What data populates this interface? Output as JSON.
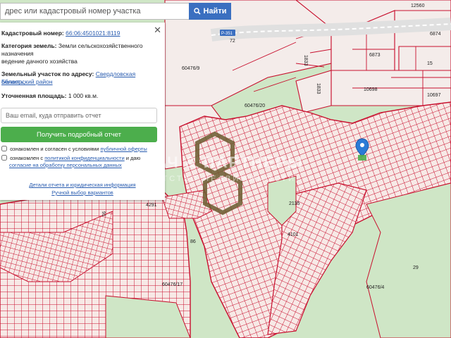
{
  "search": {
    "placeholder": "дрес или кадастровый номер участка",
    "button": "Найти"
  },
  "panel": {
    "cadastral_label": "Кадастровый номер:",
    "cadastral_value": "66:06:4501021:8119",
    "category_label": "Категория земель:",
    "category_value": "Земли сельскохозяйственного",
    "category_value_2": "назначения",
    "use_value": "ведение дачного хозяйства",
    "address_label": "Земельный участок по адресу:",
    "address_value": "Свердловская область,",
    "address_value_2": "Белоярский район",
    "area_label": "Уточненная площадь:",
    "area_value": "1 000 кв.м.",
    "email_placeholder": "Ваш email, куда отправить отчет",
    "report_button": "Получить подробный отчет",
    "consent1_text": "ознакомлен и согласен с условиями",
    "consent1_link": "публичной оферты",
    "consent2_text": "ознакомлен с",
    "consent2_link": "политикой конфиденциальности",
    "consent2_text_b": "и даю",
    "consent2_link_2": "согласие на обработку персональных данных",
    "details_link": "Детали отчета и юридическая информация",
    "manual_link": "Ручной выбор вариантов"
  },
  "map_labels": {
    "l12560": "12560",
    "l6874": "6874",
    "l6873": "6873",
    "l15": "15",
    "l1833a": "1833",
    "l1833b": "1833",
    "l10698": "10698",
    "l10697": "10697",
    "l60476_9": "60476/9",
    "l60476_20": "60476/20",
    "l4291": "4291",
    "l2135": "2135",
    "l4101": "4101",
    "l86": "86",
    "l60476_17": "60476/17",
    "l60476_4": "60476/4",
    "l29": "29",
    "l91": "91",
    "road_r": "Р-351",
    "road_72": "72"
  },
  "watermark": {
    "line1": "КАЛАЧ & ПАРТНЕРЫ",
    "line2": "АГЕНТСТВО НЕДВИЖИМОСТИ"
  },
  "colors": {
    "map_bg": "#cfe6c6",
    "parcel_fill": "#f7e9e6",
    "parcel_line": "#c8102e",
    "marker": "#2b7bd6",
    "button_blue": "#3a6fc0",
    "button_green": "#4cae4c"
  }
}
